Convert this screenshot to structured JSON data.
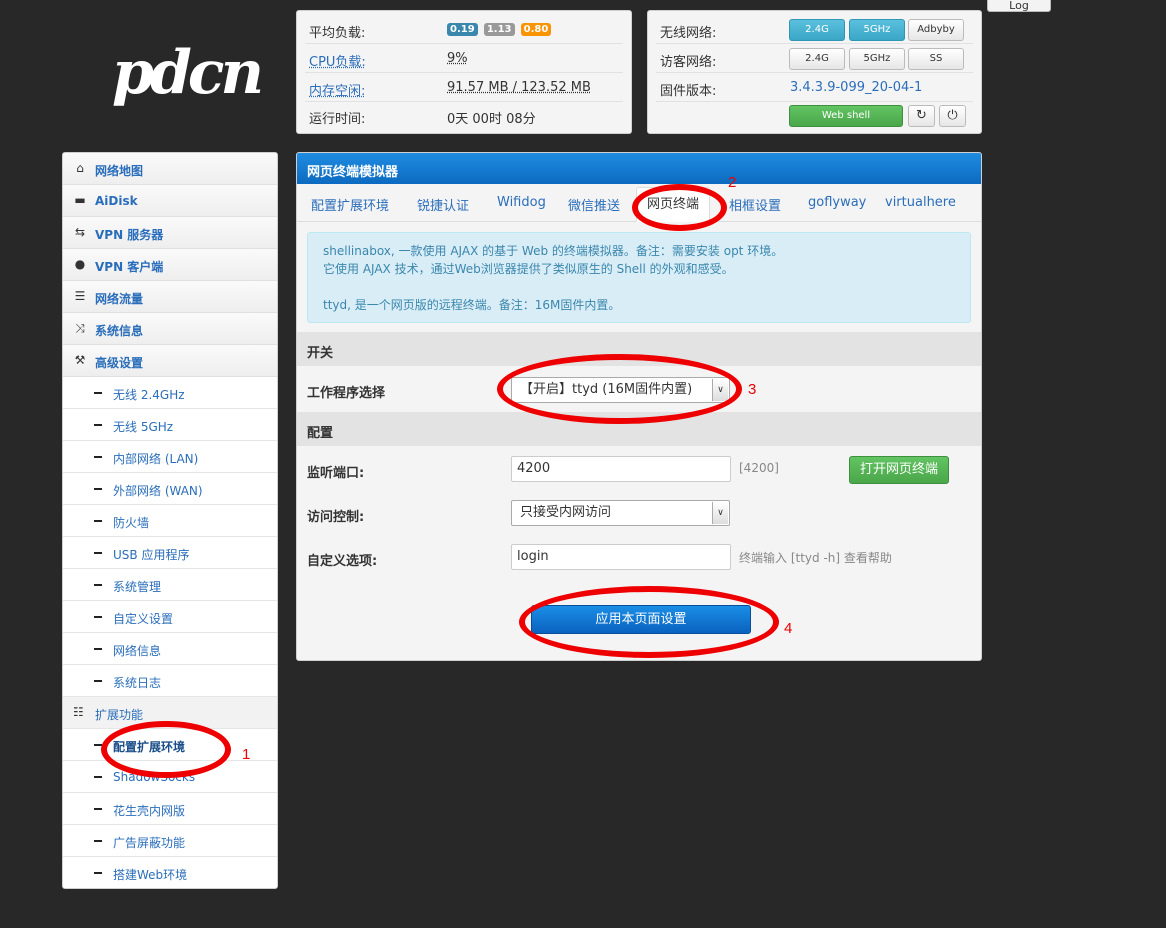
{
  "logo": {
    "text": "pdcn"
  },
  "top_button": {
    "label": "Log"
  },
  "status": {
    "rows": [
      {
        "label": "平均负载:",
        "type": "badges",
        "badges": [
          {
            "text": "0.19",
            "color": "#3a87ad"
          },
          {
            "text": "1.13",
            "color": "#999999"
          },
          {
            "text": "0.80",
            "color": "#f89406"
          }
        ]
      },
      {
        "label": "CPU负载:",
        "value": "9%"
      },
      {
        "label": "内存空闲:",
        "value": "91.57 MB / 123.52 MB"
      },
      {
        "label": "运行时间:",
        "value": "0天 00时 08分"
      }
    ]
  },
  "network": {
    "wireless_label": "无线网络:",
    "wireless_buttons": [
      "2.4G",
      "5GHz",
      "Adbyby"
    ],
    "guest_label": "访客网络:",
    "guest_buttons": [
      "2.4G",
      "5GHz",
      "SS"
    ],
    "firmware_label": "固件版本:",
    "firmware_value": "3.4.3.9-099_20-04-1",
    "webshell_label": "Web shell",
    "refresh_icon": "refresh-icon",
    "power_icon": "power-icon"
  },
  "sidebar": {
    "main_items": [
      {
        "label": "网络地图",
        "icon": "home-icon"
      },
      {
        "label": "AiDisk",
        "icon": "disk-icon"
      },
      {
        "label": "VPN 服务器",
        "icon": "retweet-icon"
      },
      {
        "label": "VPN 客户端",
        "icon": "globe-icon"
      },
      {
        "label": "网络流量",
        "icon": "hdd-icon"
      },
      {
        "label": "系统信息",
        "icon": "random-icon"
      },
      {
        "label": "高级设置",
        "icon": "wrench-icon"
      }
    ],
    "sub_items": [
      "无线 2.4GHz",
      "无线 5GHz",
      "内部网络 (LAN)",
      "外部网络 (WAN)",
      "防火墙",
      "USB 应用程序",
      "系统管理",
      "自定义设置",
      "网络信息",
      "系统日志"
    ],
    "ext_header": {
      "label": "扩展功能",
      "icon": "grid-icon"
    },
    "ext_items": [
      "配置扩展环境",
      "ShadowSocks",
      "花生壳内网版",
      "广告屏蔽功能",
      "搭建Web环境"
    ]
  },
  "main": {
    "title": "网页终端模拟器",
    "tabs": [
      "配置扩展环境",
      "锐捷认证",
      "Wifidog",
      "微信推送",
      "网页终端",
      "相框设置",
      "goflyway",
      "virtualhere"
    ],
    "active_tab": "网页终端",
    "info_lines": [
      "shellinabox, 一款使用 AJAX 的基于 Web 的终端模拟器。备注：需要安装 opt 环境。",
      "它使用 AJAX 技术，通过Web浏览器提供了类似原生的 Shell 的外观和感受。",
      "ttyd, 是一个网页版的远程终端。备注：16M固件内置。"
    ],
    "section_switch": "开关",
    "program_label": "工作程序选择",
    "program_value": "【开启】ttyd (16M固件内置)",
    "section_config": "配置",
    "port_label": "监听端口:",
    "port_value": "4200",
    "port_hint": "[4200]",
    "open_terminal_label": "打开网页终端",
    "access_label": "访问控制:",
    "access_value": "只接受内网访问",
    "custom_label": "自定义选项:",
    "custom_value": "login",
    "custom_hint": "终端输入 [ttyd -h] 查看帮助",
    "apply_label": "应用本页面设置"
  },
  "annotations": [
    "1",
    "2",
    "3",
    "4"
  ]
}
